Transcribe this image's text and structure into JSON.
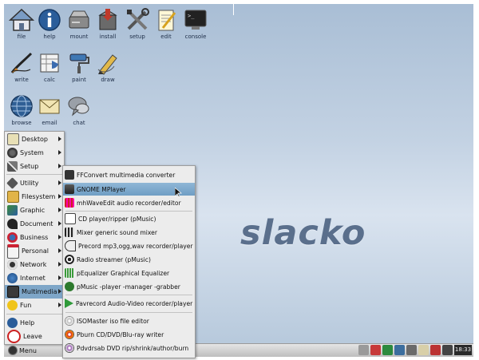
{
  "desktop_icons": [
    {
      "label": "file",
      "icon": "home-icon"
    },
    {
      "label": "help",
      "icon": "info-icon"
    },
    {
      "label": "mount",
      "icon": "drive-icon"
    },
    {
      "label": "install",
      "icon": "package-icon"
    },
    {
      "label": "setup",
      "icon": "tools-icon"
    },
    {
      "label": "edit",
      "icon": "notepad-icon"
    },
    {
      "label": "console",
      "icon": "terminal-icon"
    },
    {
      "label": "write",
      "icon": "pen-icon"
    },
    {
      "label": "calc",
      "icon": "spreadsheet-icon"
    },
    {
      "label": "paint",
      "icon": "paint-roller-icon"
    },
    {
      "label": "draw",
      "icon": "pencil-icon"
    },
    {
      "label": "browse",
      "icon": "globe-icon"
    },
    {
      "label": "email",
      "icon": "envelope-icon"
    },
    {
      "label": "chat",
      "icon": "chat-bubble-icon"
    }
  ],
  "logo_text": "slacko",
  "main_menu": {
    "items": [
      {
        "label": "Desktop",
        "submenu": true
      },
      {
        "label": "System",
        "submenu": true
      },
      {
        "label": "Setup",
        "submenu": true
      },
      {
        "label": "Utility",
        "submenu": true
      },
      {
        "label": "Filesystem",
        "submenu": true
      },
      {
        "label": "Graphic",
        "submenu": true
      },
      {
        "label": "Document",
        "submenu": true
      },
      {
        "label": "Business",
        "submenu": true
      },
      {
        "label": "Personal",
        "submenu": true
      },
      {
        "label": "Network",
        "submenu": true
      },
      {
        "label": "Internet",
        "submenu": true
      },
      {
        "label": "Multimedia",
        "submenu": true,
        "active": true
      },
      {
        "label": "Fun",
        "submenu": true
      },
      {
        "label": "Help",
        "submenu": false
      },
      {
        "label": "Leave",
        "submenu": false
      }
    ]
  },
  "multimedia_menu": {
    "items": [
      {
        "label": "FFConvert multimedia converter"
      },
      {
        "label": "GNOME MPlayer",
        "active": true
      },
      {
        "label": "mhWaveEdit audio recorder/editor"
      },
      {
        "label": "CD player/ripper (pMusic)"
      },
      {
        "label": "Mixer generic sound mixer"
      },
      {
        "label": "Precord mp3,ogg,wav recorder/player"
      },
      {
        "label": "Radio streamer (pMusic)"
      },
      {
        "label": "pEqualizer Graphical Equalizer"
      },
      {
        "label": "pMusic -player -manager -grabber"
      },
      {
        "label": "Pavrecord Audio-Video recorder/player"
      },
      {
        "label": "ISOMaster iso file editor"
      },
      {
        "label": "Pburn CD/DVD/Blu-ray writer"
      },
      {
        "label": "Pdvdrsab DVD rip/shrink/author/burn"
      }
    ]
  },
  "taskbar": {
    "menu_label": "Menu",
    "clock": "18:33"
  },
  "colors": {
    "desktop_top": "#a9bed5",
    "desktop_mid": "#d9e3ef",
    "menu_bg": "#ececec",
    "highlight": "#7ea6c8"
  }
}
